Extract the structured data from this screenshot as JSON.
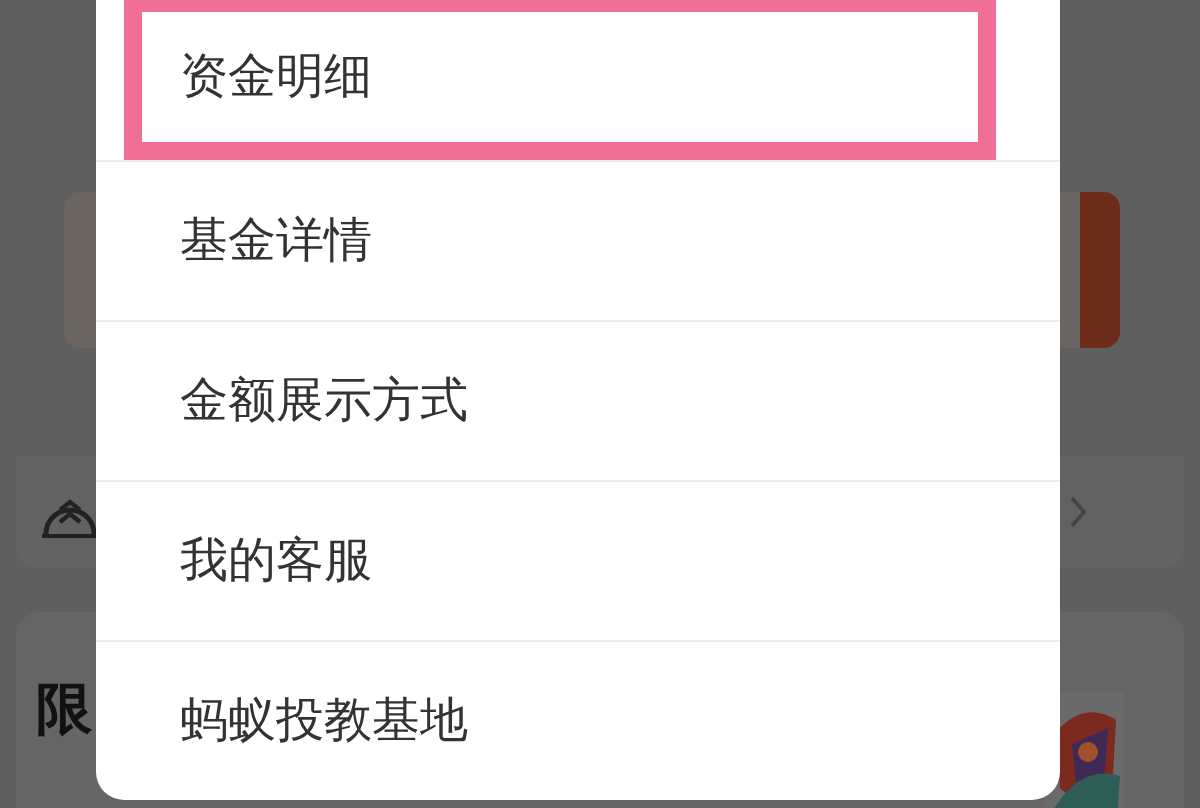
{
  "background": {
    "card_heading": "限"
  },
  "menu": {
    "items": [
      {
        "label": "资金明细",
        "highlighted": true
      },
      {
        "label": "基金详情",
        "highlighted": false
      },
      {
        "label": "金额展示方式",
        "highlighted": false
      },
      {
        "label": "我的客服",
        "highlighted": false
      },
      {
        "label": "蚂蚁投教基地",
        "highlighted": false
      }
    ]
  }
}
